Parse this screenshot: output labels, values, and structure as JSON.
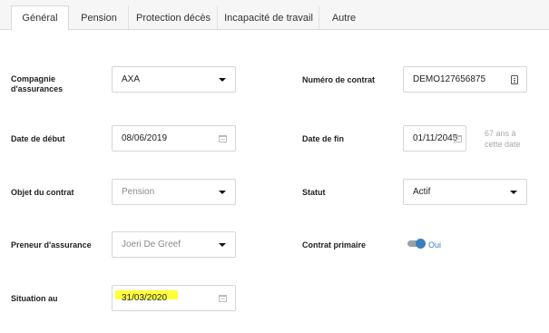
{
  "tabs": [
    {
      "label": "Général",
      "active": true
    },
    {
      "label": "Pension",
      "active": false
    },
    {
      "label": "Protection décès",
      "active": false
    },
    {
      "label": "Incapacité de travail",
      "active": false
    },
    {
      "label": "Autre",
      "active": false
    }
  ],
  "form": {
    "compagnie": {
      "label": "Compagnie\nd'assurances",
      "value": "AXA"
    },
    "numero_contrat": {
      "label": "Numéro de contrat",
      "value": "DEMO127656875"
    },
    "date_debut": {
      "label": "Date de début",
      "value": "08/06/2019"
    },
    "date_fin": {
      "label": "Date de fin",
      "value": "01/11/2045",
      "hint": "67 ans à\ncette date"
    },
    "objet": {
      "label": "Objet du contrat",
      "value": "Pension"
    },
    "statut": {
      "label": "Statut",
      "value": "Actif"
    },
    "preneur": {
      "label": "Preneur d'assurance",
      "value": "Joeri De Greef"
    },
    "contrat_primaire": {
      "label": "Contrat primaire",
      "toggle_label": "Oui",
      "on": true
    },
    "situation": {
      "label": "Situation au",
      "value": "31/03/2020"
    }
  },
  "colors": {
    "accent": "#3a7fc0",
    "highlight": "#ffff3c",
    "border": "#d6d6d6"
  },
  "icons": [
    "chevron-down-icon",
    "calendar-icon",
    "id-card-icon"
  ]
}
